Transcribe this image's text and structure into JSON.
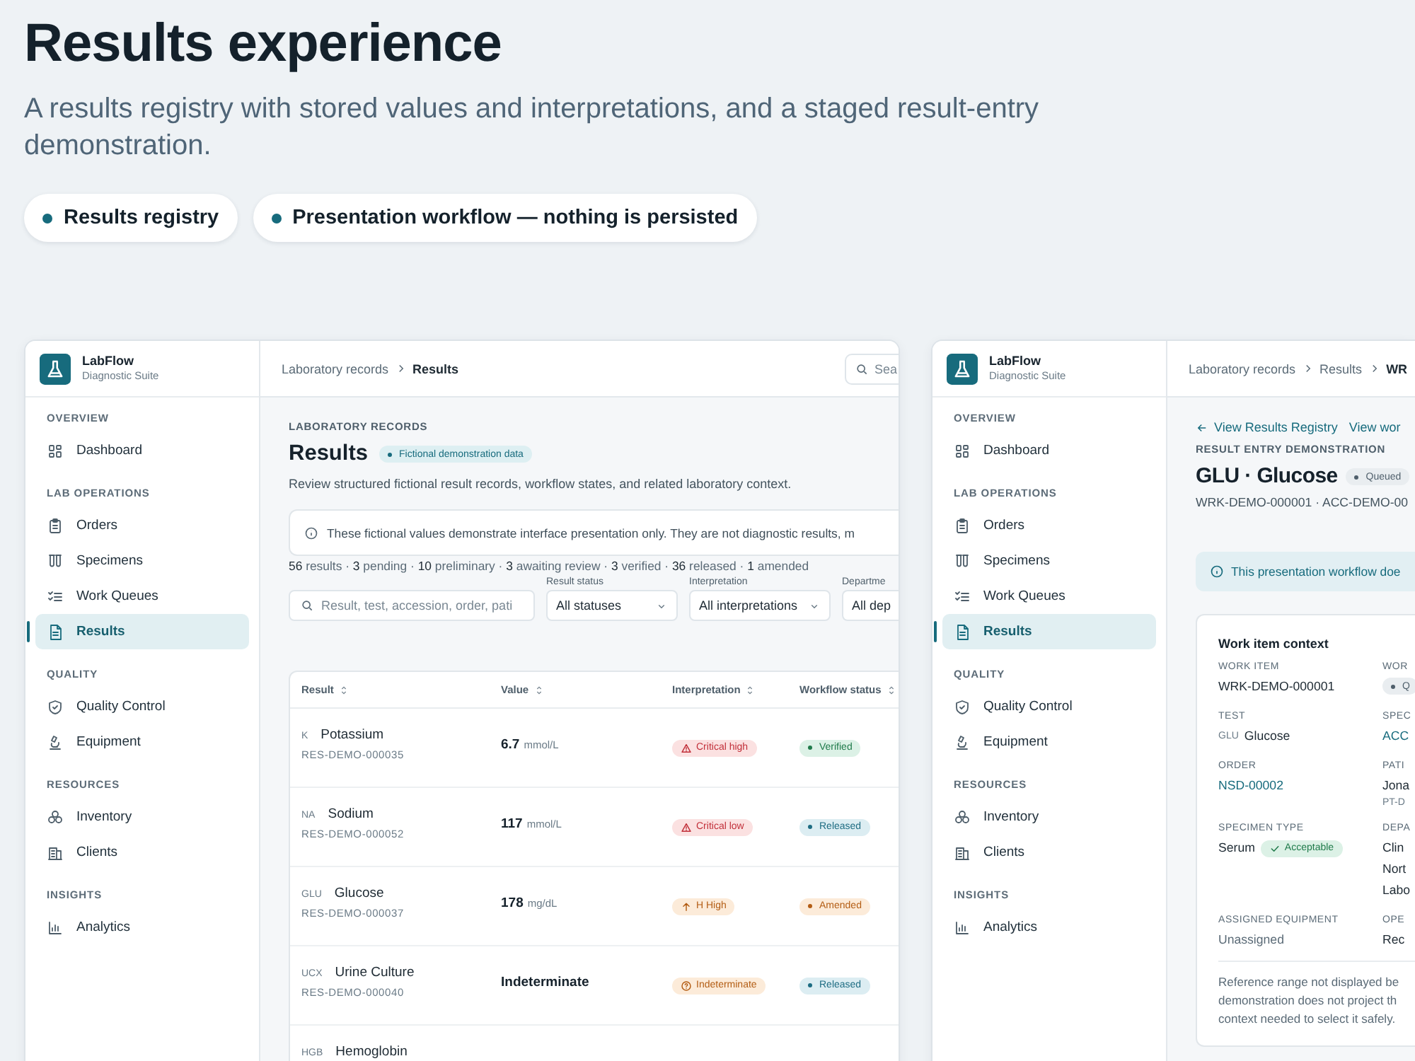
{
  "page": {
    "title": "Results experience",
    "subtitle": "A results registry with stored values and interpretations, and a staged result-entry demonstration.",
    "pills": [
      "Results registry",
      "Presentation workflow — nothing is persisted"
    ]
  },
  "registry": {
    "brand": {
      "name": "LabFlow",
      "tagline": "Diagnostic Suite"
    },
    "sidebar": [
      {
        "heading": "OVERVIEW",
        "items": [
          {
            "label": "Dashboard",
            "selected": false
          }
        ]
      },
      {
        "heading": "LAB OPERATIONS",
        "items": [
          {
            "label": "Orders",
            "selected": false
          },
          {
            "label": "Specimens",
            "selected": false
          },
          {
            "label": "Work Queues",
            "selected": false
          },
          {
            "label": "Results",
            "selected": true
          }
        ]
      },
      {
        "heading": "QUALITY",
        "items": [
          {
            "label": "Quality Control",
            "selected": false
          },
          {
            "label": "Equipment",
            "selected": false
          }
        ]
      },
      {
        "heading": "RESOURCES",
        "items": [
          {
            "label": "Inventory",
            "selected": false
          },
          {
            "label": "Clients",
            "selected": false
          }
        ]
      },
      {
        "heading": "INSIGHTS",
        "items": [
          {
            "label": "Analytics",
            "selected": false
          }
        ]
      }
    ],
    "breadcrumb": [
      "Laboratory records",
      "Results"
    ],
    "search": {
      "placeholder": "Sea"
    },
    "eyebrow": "LABORATORY RECORDS",
    "title": "Results",
    "badge": "Fictional demonstration data",
    "description": "Review structured fictional result records, workflow states, and related laboratory context.",
    "notice": "These fictional values demonstrate interface presentation only. They are not diagnostic results, m",
    "stats": "**56** results · **3** pending · **10** preliminary · **3** awaiting review · **3** verified · **36** released · **1** amended",
    "search_field": {
      "placeholder": "Result, test, accession, order, pati"
    },
    "filters": [
      {
        "label": "Result status",
        "value": "All statuses"
      },
      {
        "label": "Interpretation",
        "value": "All interpretations"
      },
      {
        "label": "Departme",
        "value": "All dep"
      }
    ],
    "table": {
      "columns": [
        "Result",
        "Value",
        "Interpretation",
        "Workflow status"
      ],
      "rows": [
        {
          "code": "K",
          "name": "Potassium",
          "id": "RES-DEMO-000035",
          "value": "6.7",
          "unit": "mmol/L",
          "interpretation": {
            "kind": "critical",
            "label": "Critical high"
          },
          "status": {
            "kind": "verified",
            "label": "Verified"
          }
        },
        {
          "code": "NA",
          "name": "Sodium",
          "id": "RES-DEMO-000052",
          "value": "117",
          "unit": "mmol/L",
          "interpretation": {
            "kind": "critical",
            "label": "Critical low"
          },
          "status": {
            "kind": "released",
            "label": "Released"
          }
        },
        {
          "code": "GLU",
          "name": "Glucose",
          "id": "RES-DEMO-000037",
          "value": "178",
          "unit": "mg/dL",
          "interpretation": {
            "kind": "high",
            "label": "H High"
          },
          "status": {
            "kind": "amended",
            "label": "Amended"
          }
        },
        {
          "code": "UCX",
          "name": "Urine Culture",
          "id": "RES-DEMO-000040",
          "value": "Indeterminate",
          "interpretation": {
            "kind": "indeterminate",
            "label": "Indeterminate"
          },
          "status": {
            "kind": "released",
            "label": "Released"
          }
        },
        {
          "code": "HGB",
          "name": "Hemoglobin"
        }
      ]
    }
  },
  "entry": {
    "brand": {
      "name": "LabFlow",
      "tagline": "Diagnostic Suite"
    },
    "sidebar": [
      {
        "heading": "OVERVIEW",
        "items": [
          {
            "label": "Dashboard",
            "selected": false
          }
        ]
      },
      {
        "heading": "LAB OPERATIONS",
        "items": [
          {
            "label": "Orders",
            "selected": false
          },
          {
            "label": "Specimens",
            "selected": false
          },
          {
            "label": "Work Queues",
            "selected": false
          },
          {
            "label": "Results",
            "selected": true
          }
        ]
      },
      {
        "heading": "QUALITY",
        "items": [
          {
            "label": "Quality Control",
            "selected": false
          },
          {
            "label": "Equipment",
            "selected": false
          }
        ]
      },
      {
        "heading": "RESOURCES",
        "items": [
          {
            "label": "Inventory",
            "selected": false
          },
          {
            "label": "Clients",
            "selected": false
          }
        ]
      },
      {
        "heading": "INSIGHTS",
        "items": [
          {
            "label": "Analytics",
            "selected": false
          }
        ]
      }
    ],
    "breadcrumb": [
      "Laboratory records",
      "Results",
      "WR"
    ],
    "links": [
      "View Results Registry",
      "View wor"
    ],
    "eyebrow": "RESULT ENTRY DEMONSTRATION",
    "title": "GLU · Glucose",
    "status": {
      "kind": "queued",
      "label": "Queued"
    },
    "ids": "WRK-DEMO-000001 · ACC-DEMO-00",
    "notice": "This presentation workflow doe",
    "card": {
      "title": "Work item context",
      "fields": [
        {
          "label": "WORK ITEM",
          "kind": "text",
          "value": "WRK-DEMO-000001"
        },
        {
          "label": "WOR",
          "kind": "status",
          "value": "Q"
        },
        {
          "label": "TEST",
          "kind": "text",
          "code": "GLU",
          "value": "Glucose"
        },
        {
          "label": "SPEC",
          "kind": "link",
          "value": "ACC"
        },
        {
          "label": "ORDER",
          "kind": "link",
          "value": "NSD-00002"
        },
        {
          "label": "PATI",
          "kind": "text",
          "value": "Jona",
          "sub": "PT-D"
        },
        {
          "label": "SPECIMEN TYPE",
          "kind": "text",
          "value": "Serum",
          "tag": "Acceptable"
        },
        {
          "label": "DEPA",
          "kind": "lines",
          "lines": [
            "Clin",
            "Nort",
            "Labo"
          ]
        },
        {
          "label": "ASSIGNED EQUIPMENT",
          "kind": "muted",
          "value": "Unassigned"
        },
        {
          "label": "OPE",
          "kind": "text",
          "value": "Rec"
        }
      ],
      "note": [
        "Reference range not displayed be",
        "demonstration does not project th",
        "context needed to select it safely."
      ]
    }
  }
}
